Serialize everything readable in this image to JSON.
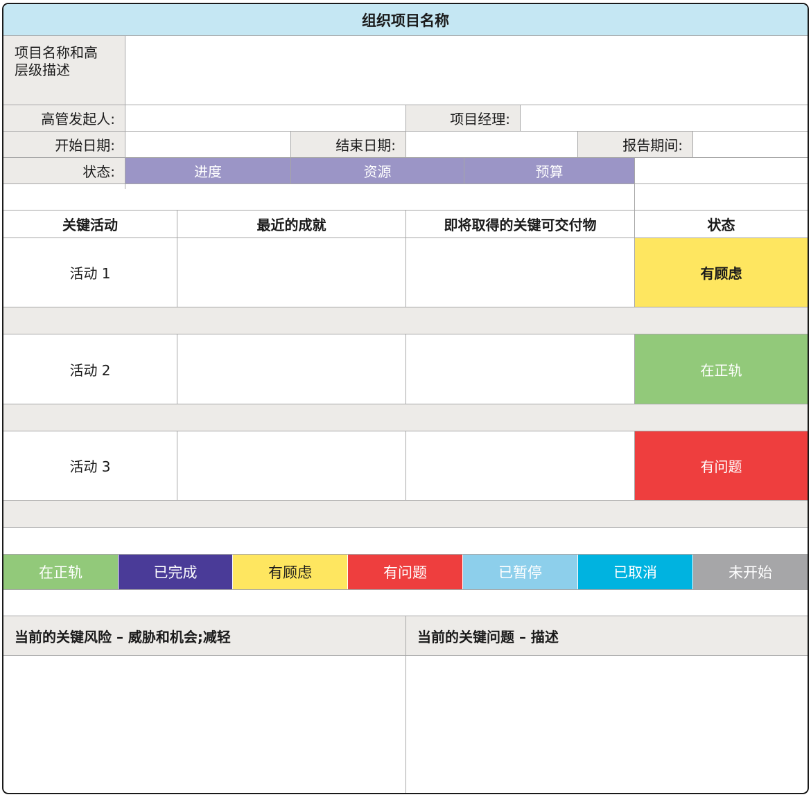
{
  "header": {
    "title": "组织项目名称"
  },
  "project": {
    "description_label": "项目名称和高\n层级描述",
    "description_value": "",
    "sponsor_label": "高管发起人:",
    "sponsor_value": "",
    "manager_label": "项目经理:",
    "manager_value": "",
    "start_label": "开始日期:",
    "start_value": "",
    "end_label": "结束日期:",
    "end_value": "",
    "period_label": "报告期间:",
    "period_value": ""
  },
  "status_row": {
    "label": "状态:",
    "schedule": "进度",
    "resources": "资源",
    "budget": "预算",
    "color": "#9b95c6"
  },
  "activities": {
    "headers": {
      "activity": "关键活动",
      "achievements": "最近的成就",
      "deliverables": "即将取得的关键可交付物",
      "status": "状态"
    },
    "rows": [
      {
        "name": "活动 1",
        "achievements": "",
        "deliverables": "",
        "status": "有顾虑",
        "status_color": "#fee660"
      },
      {
        "name": "活动 2",
        "achievements": "",
        "deliverables": "",
        "status": "在正轨",
        "status_color": "#92c97a"
      },
      {
        "name": "活动 3",
        "achievements": "",
        "deliverables": "",
        "status": "有问题",
        "status_color": "#ee3e3e"
      }
    ]
  },
  "legend": [
    {
      "label": "在正轨",
      "color": "#92c97a"
    },
    {
      "label": "已完成",
      "color": "#4a3b98"
    },
    {
      "label": "有顾虑",
      "color": "#fee660"
    },
    {
      "label": "有问题",
      "color": "#ee3e3e"
    },
    {
      "label": "已暂停",
      "color": "#8dcfeb"
    },
    {
      "label": "已取消",
      "color": "#00b3e0"
    },
    {
      "label": "未开始",
      "color": "#a6a6a8"
    }
  ],
  "risks": {
    "risks_label": "当前的关键风险 – 威胁和机会;减轻",
    "risks_value": "",
    "issues_label": "当前的关键问题 – 描述",
    "issues_value": ""
  }
}
